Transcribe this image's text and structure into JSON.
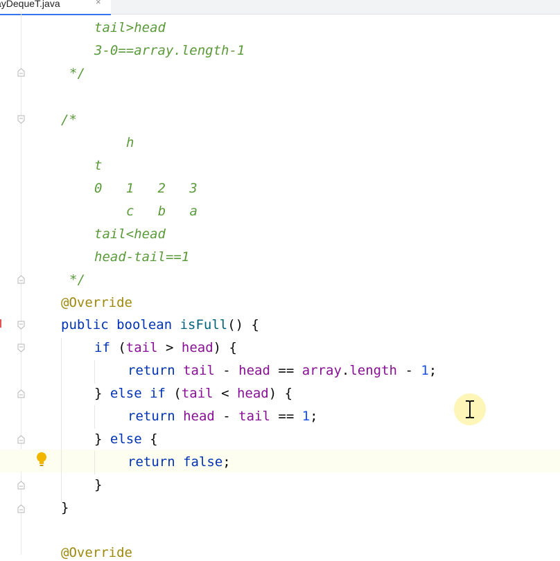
{
  "tab": {
    "title": "ayDequeT.java",
    "close_icon": "×"
  },
  "code": [
    {
      "tokens": [
        {
          "t": "tail>head",
          "c": "comment"
        }
      ]
    },
    {
      "tokens": [
        {
          "t": "3-0==array.length-1",
          "c": "comment"
        }
      ]
    },
    {
      "tokens": [
        {
          "t": "*/",
          "c": "comment"
        }
      ]
    },
    {
      "tokens": [
        {
          "t": "/*",
          "c": "comment"
        }
      ]
    },
    {
      "tokens": [
        {
          "t": "h",
          "c": "comment"
        }
      ]
    },
    {
      "tokens": [
        {
          "t": "t",
          "c": "comment"
        }
      ]
    },
    {
      "tokens": [
        {
          "t": "0   1   2   3",
          "c": "comment"
        }
      ]
    },
    {
      "tokens": [
        {
          "t": "c   b   a",
          "c": "comment"
        }
      ]
    },
    {
      "tokens": [
        {
          "t": "tail<head",
          "c": "comment"
        }
      ]
    },
    {
      "tokens": [
        {
          "t": "head-tail==1",
          "c": "comment"
        }
      ]
    },
    {
      "tokens": [
        {
          "t": "*/",
          "c": "comment"
        }
      ]
    },
    {
      "tokens": [
        {
          "t": "@Override",
          "c": "ann"
        }
      ]
    },
    {
      "tokens": [
        {
          "t": "public boolean ",
          "c": "kw"
        },
        {
          "t": "isFull",
          "c": "fn"
        },
        {
          "t": "() {",
          "c": "plain"
        }
      ]
    },
    {
      "tokens": [
        {
          "t": "if ",
          "c": "kw"
        },
        {
          "t": "(",
          "c": "plain"
        },
        {
          "t": "tail",
          "c": "fld"
        },
        {
          "t": " > ",
          "c": "plain"
        },
        {
          "t": "head",
          "c": "fld"
        },
        {
          "t": ") {",
          "c": "plain"
        }
      ]
    },
    {
      "tokens": [
        {
          "t": "return ",
          "c": "kw"
        },
        {
          "t": "tail",
          "c": "fld"
        },
        {
          "t": " - ",
          "c": "plain"
        },
        {
          "t": "head",
          "c": "fld"
        },
        {
          "t": " == ",
          "c": "plain"
        },
        {
          "t": "array",
          "c": "fld"
        },
        {
          "t": ".",
          "c": "plain"
        },
        {
          "t": "length",
          "c": "fld"
        },
        {
          "t": " - ",
          "c": "plain"
        },
        {
          "t": "1",
          "c": "num"
        },
        {
          "t": ";",
          "c": "plain"
        }
      ]
    },
    {
      "tokens": [
        {
          "t": "} ",
          "c": "plain"
        },
        {
          "t": "else if ",
          "c": "kw"
        },
        {
          "t": "(",
          "c": "plain"
        },
        {
          "t": "tail",
          "c": "fld"
        },
        {
          "t": " < ",
          "c": "plain"
        },
        {
          "t": "head",
          "c": "fld"
        },
        {
          "t": ") {",
          "c": "plain"
        }
      ]
    },
    {
      "tokens": [
        {
          "t": "return ",
          "c": "kw"
        },
        {
          "t": "head",
          "c": "fld"
        },
        {
          "t": " - ",
          "c": "plain"
        },
        {
          "t": "tail",
          "c": "fld"
        },
        {
          "t": " == ",
          "c": "plain"
        },
        {
          "t": "1",
          "c": "num"
        },
        {
          "t": ";",
          "c": "plain"
        }
      ]
    },
    {
      "tokens": [
        {
          "t": "} ",
          "c": "plain"
        },
        {
          "t": "else ",
          "c": "kw"
        },
        {
          "t": "{",
          "c": "plain"
        }
      ]
    },
    {
      "tokens": [
        {
          "t": "return false",
          "c": "kw"
        },
        {
          "t": ";",
          "c": "plain"
        }
      ]
    },
    {
      "tokens": [
        {
          "t": "}",
          "c": "plain"
        }
      ]
    },
    {
      "tokens": [
        {
          "t": "}",
          "c": "plain"
        }
      ]
    },
    {
      "tokens": [
        {
          "t": "@Override",
          "c": "ann"
        }
      ]
    }
  ],
  "icons": {
    "fold": "fold-marker-icon",
    "bulb": "lightbulb-icon",
    "cursor": "text-cursor-icon"
  },
  "colors": {
    "comment": "#5a9a3a",
    "keyword": "#0033b3",
    "field": "#871094",
    "number": "#1750eb",
    "annotation": "#9e880d",
    "method": "#00627a"
  }
}
